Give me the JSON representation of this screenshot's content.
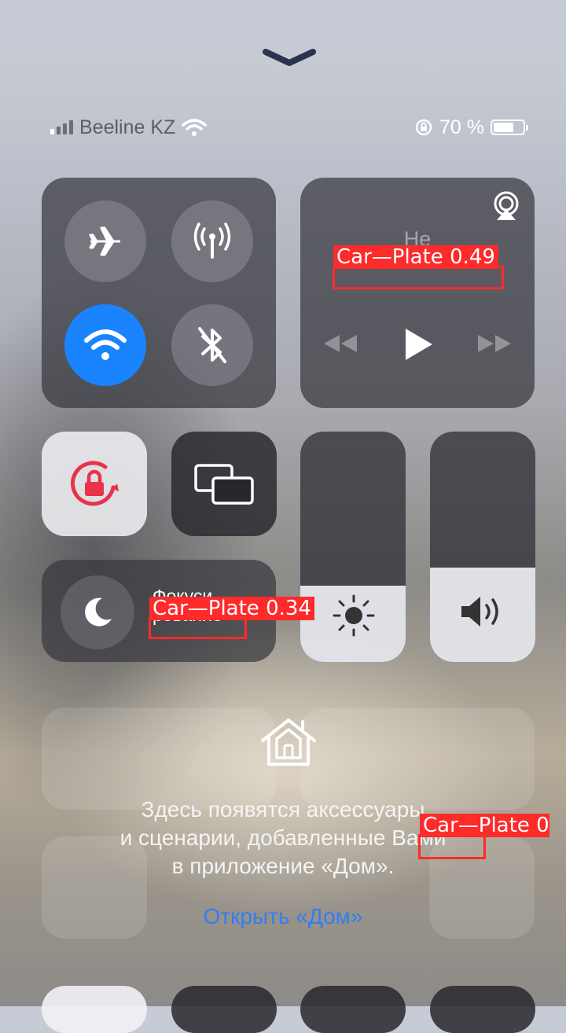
{
  "status_bar": {
    "carrier": "Beeline KZ",
    "signal_bars_on": 1,
    "signal_bars_total": 4,
    "battery_percent": "70 %",
    "battery_level": 0.7
  },
  "connectivity": {
    "airplane_icon": "airplane-icon",
    "cellular_icon": "antenna-icon",
    "wifi_icon": "wifi-icon",
    "wifi_active": true,
    "bluetooth_icon": "bluetooth-off-icon"
  },
  "media": {
    "title_line1": "Не",
    "title_line2": "исполняется"
  },
  "focus": {
    "label_line1": "Фокуси",
    "label_line2": "рование"
  },
  "sliders": {
    "brightness_level": 0.33,
    "volume_level": 0.41
  },
  "home": {
    "line1": "Здесь появятся аксессуары",
    "line2": "и сценарии, добавленные Вами",
    "line3": "в приложение «Дом».",
    "link": "Открыть «Дом»"
  },
  "detections": [
    {
      "label": "Car—Plate 0.49",
      "text": "исполняется"
    },
    {
      "label": "Car—Plate 0.34",
      "text": "рование"
    },
    {
      "label": "Car—Plate 0",
      "text": "Вами"
    }
  ],
  "colors": {
    "accent": "#1a84ff",
    "link": "#2f7ff2",
    "rotation_lock": "#e8334a",
    "detection": "#ff2a2a"
  }
}
